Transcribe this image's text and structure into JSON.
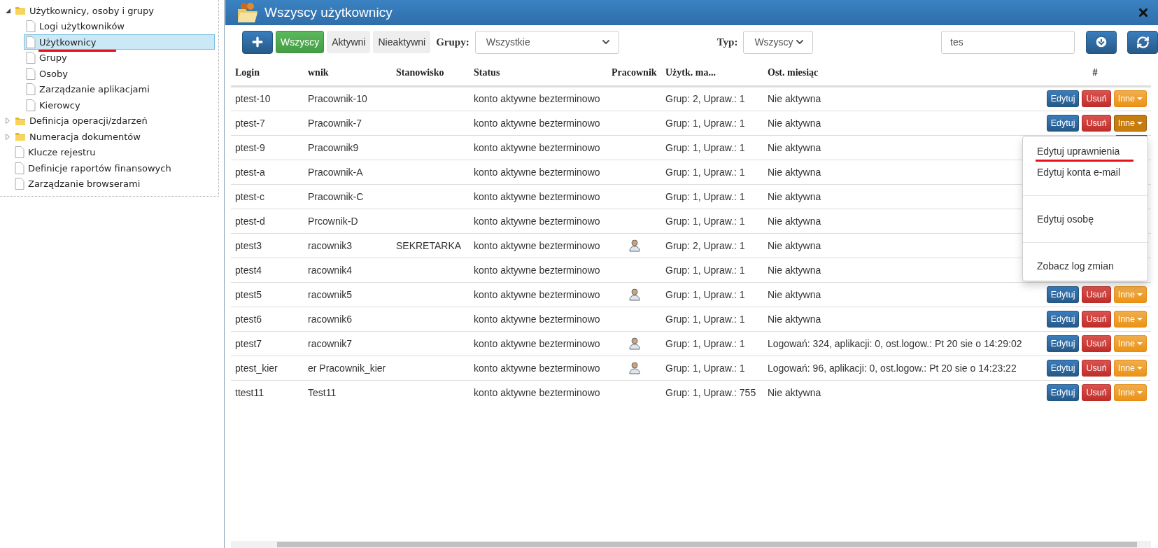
{
  "tree": [
    {
      "label": "Użytkownicy, osoby i grupy",
      "kind": "folder",
      "expanded": true,
      "selected": false,
      "marked": false,
      "children": [
        {
          "label": "Logi użytkowników",
          "kind": "page",
          "selected": false,
          "marked": false
        },
        {
          "label": "Użytkownicy",
          "kind": "page",
          "selected": true,
          "marked": true
        },
        {
          "label": "Grupy",
          "kind": "page",
          "selected": false,
          "marked": false
        },
        {
          "label": "Osoby",
          "kind": "page",
          "selected": false,
          "marked": false
        },
        {
          "label": "Zarządzanie aplikacjami",
          "kind": "page",
          "selected": false,
          "marked": false
        },
        {
          "label": "Kierowcy",
          "kind": "page",
          "selected": false,
          "marked": false
        }
      ]
    },
    {
      "label": "Definicja operacji/zdarzeń",
      "kind": "folder",
      "expanded": false,
      "selected": false,
      "marked": false
    },
    {
      "label": "Numeracja dokumentów",
      "kind": "folder",
      "expanded": false,
      "selected": false,
      "marked": false
    },
    {
      "label": "Klucze rejestru",
      "kind": "page",
      "selected": false,
      "marked": false
    },
    {
      "label": "Definicje raportów finansowych",
      "kind": "page",
      "selected": false,
      "marked": false
    },
    {
      "label": "Zarządzanie browserami",
      "kind": "page",
      "selected": false,
      "marked": false
    }
  ],
  "panel": {
    "title": "Wszyscy użytkownicy"
  },
  "toolbar": {
    "filters": [
      {
        "label": "Wszyscy",
        "selected": true
      },
      {
        "label": "Aktywni",
        "selected": false
      },
      {
        "label": "Nieaktywni",
        "selected": false
      }
    ],
    "groups_label": "Grupy:",
    "groups_value": "Wszystkie",
    "type_label": "Typ:",
    "type_value": "Wszyscy",
    "search_value": "tes"
  },
  "table": {
    "columns": [
      "Login",
      "wnik",
      "Stanowisko",
      "Status",
      "Pracownik",
      "Użytk. ma...",
      "Ost. miesiąc",
      "#"
    ],
    "rows": [
      {
        "login": "ptest-10",
        "name": "Pracownik-10",
        "position": "",
        "status": "konto aktywne bezterminowo",
        "employee": false,
        "groups": "Grup: 2, Upraw.: 1",
        "last_month": "Nie aktywna",
        "menu_open": false,
        "buttons": {
          "edit": "Edytuj",
          "delete": "Usuń",
          "more": "Inne"
        }
      },
      {
        "login": "ptest-7",
        "name": "Pracownik-7",
        "position": "",
        "status": "konto aktywne bezterminowo",
        "employee": false,
        "groups": "Grup: 1, Upraw.: 1",
        "last_month": "Nie aktywna",
        "menu_open": true,
        "buttons": {
          "edit": "Edytuj",
          "delete": "Usuń",
          "more": "Inne"
        }
      },
      {
        "login": "ptest-9",
        "name": "Pracownik9",
        "position": "",
        "status": "konto aktywne bezterminowo",
        "employee": false,
        "groups": "Grup: 1, Upraw.: 1",
        "last_month": "Nie aktywna"
      },
      {
        "login": "ptest-a",
        "name": "Pracownik-A",
        "position": "",
        "status": "konto aktywne bezterminowo",
        "employee": false,
        "groups": "Grup: 1, Upraw.: 1",
        "last_month": "Nie aktywna"
      },
      {
        "login": "ptest-c",
        "name": "Pracownik-C",
        "position": "",
        "status": "konto aktywne bezterminowo",
        "employee": false,
        "groups": "Grup: 1, Upraw.: 1",
        "last_month": "Nie aktywna"
      },
      {
        "login": "ptest-d",
        "name": "Prcownik-D",
        "position": "",
        "status": "konto aktywne bezterminowo",
        "employee": false,
        "groups": "Grup: 1, Upraw.: 1",
        "last_month": "Nie aktywna"
      },
      {
        "login": "ptest3",
        "name": "racownik3",
        "position": "SEKRETARKA",
        "status": "konto aktywne bezterminowo",
        "employee": true,
        "groups": "Grup: 2, Upraw.: 1",
        "last_month": "Nie aktywna"
      },
      {
        "login": "ptest4",
        "name": "racownik4",
        "position": "",
        "status": "konto aktywne bezterminowo",
        "employee": false,
        "groups": "Grup: 1, Upraw.: 1",
        "last_month": "Nie aktywna"
      },
      {
        "login": "ptest5",
        "name": "racownik5",
        "position": "",
        "status": "konto aktywne bezterminowo",
        "employee": true,
        "groups": "Grup: 1, Upraw.: 1",
        "last_month": "Nie aktywna",
        "menu_open": false,
        "buttons": {
          "edit": "Edytuj",
          "delete": "Usuń",
          "more": "Inne"
        }
      },
      {
        "login": "ptest6",
        "name": "racownik6",
        "position": "",
        "status": "konto aktywne bezterminowo",
        "employee": false,
        "groups": "Grup: 1, Upraw.: 1",
        "last_month": "Nie aktywna",
        "menu_open": false,
        "buttons": {
          "edit": "Edytuj",
          "delete": "Usuń",
          "more": "Inne"
        }
      },
      {
        "login": "ptest7",
        "name": "racownik7",
        "position": "",
        "status": "konto aktywne bezterminowo",
        "employee": true,
        "groups": "Grup: 1, Upraw.: 1",
        "last_month": "Logowań: 324, aplikacji: 0, ost.logow.: Pt 20 sie o 14:29:02",
        "menu_open": false,
        "buttons": {
          "edit": "Edytuj",
          "delete": "Usuń",
          "more": "Inne"
        }
      },
      {
        "login": "ptest_kier",
        "name": "er Pracownik_kier",
        "position": "",
        "status": "konto aktywne bezterminowo",
        "employee": true,
        "groups": "Grup: 1, Upraw.: 1",
        "last_month": "Logowań: 96, aplikacji: 0, ost.logow.: Pt 20 sie o 14:23:22",
        "menu_open": false,
        "buttons": {
          "edit": "Edytuj",
          "delete": "Usuń",
          "more": "Inne"
        }
      },
      {
        "login": "ttest11",
        "name": "Test11",
        "position": "",
        "status": "konto aktywne bezterminowo",
        "employee": false,
        "groups": "Grup: 1, Upraw.: 755",
        "last_month": "Nie aktywna",
        "menu_open": false,
        "buttons": {
          "edit": "Edytuj",
          "delete": "Usuń",
          "more": "Inne"
        }
      }
    ],
    "row_menu": [
      {
        "kind": "item",
        "label": "Edytuj uprawnienia",
        "marked": true
      },
      {
        "kind": "item",
        "label": "Edytuj konta e-mail",
        "marked": false
      },
      {
        "kind": "divider"
      },
      {
        "kind": "item",
        "label": "Edytuj osobę",
        "marked": false
      },
      {
        "kind": "divider"
      },
      {
        "kind": "item",
        "label": "Zobacz log zmian",
        "marked": false
      }
    ]
  }
}
